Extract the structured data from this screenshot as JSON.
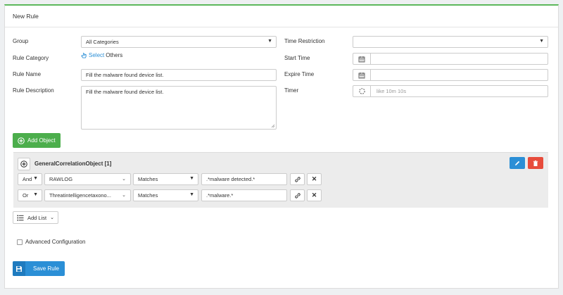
{
  "header": {
    "title": "New Rule"
  },
  "form": {
    "group_label": "Group",
    "group_value": "All Categories",
    "category_label": "Rule Category",
    "category_select": "Select",
    "category_others": "Others",
    "name_label": "Rule Name",
    "name_value": "Fill the malware found device list.",
    "desc_label": "Rule Description",
    "desc_value": "Fill the malware found device list.",
    "time_restriction_label": "Time Restriction",
    "time_restriction_value": "",
    "start_time_label": "Start Time",
    "start_time_value": "",
    "expire_time_label": "Expire Time",
    "expire_time_value": "",
    "timer_label": "Timer",
    "timer_placeholder": "like 10m 10s"
  },
  "add_object_label": "Add Object",
  "object": {
    "title": "GeneralCorrelationObject [1]",
    "rows": [
      {
        "logic": "And",
        "field": "RAWLOG",
        "operator": "Matches",
        "value": ".*malware detected.*"
      },
      {
        "logic": "Or",
        "field": "Threatintelligencetaxono...",
        "operator": "Matches",
        "value": ".*malware.*"
      }
    ]
  },
  "add_list_label": "Add List",
  "advanced_label": "Advanced Configuration",
  "save_label": "Save Rule",
  "colors": {
    "accent_green": "#5cb85c",
    "blue": "#2b8fd6",
    "red": "#e74c3c"
  }
}
